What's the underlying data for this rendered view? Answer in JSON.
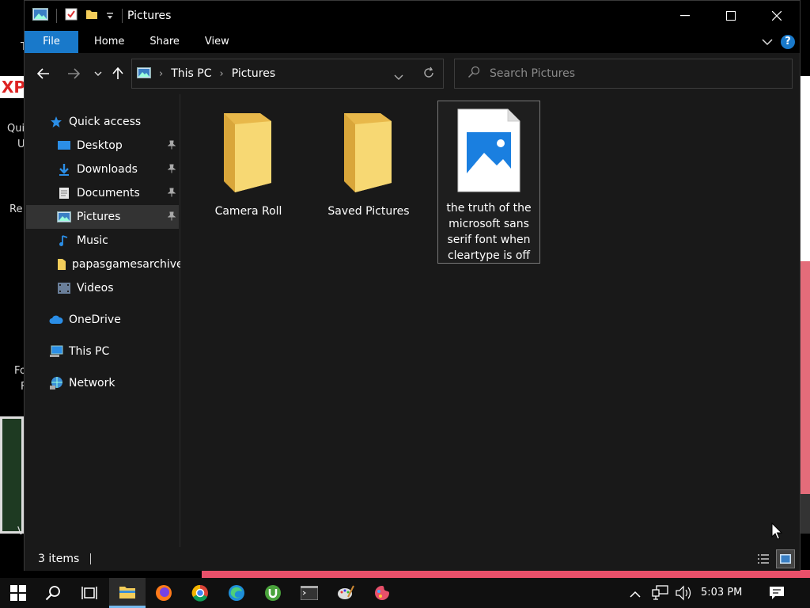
{
  "window": {
    "title": "Pictures",
    "ribbon_tabs": [
      "File",
      "Home",
      "Share",
      "View"
    ]
  },
  "address": {
    "crumbs": [
      "This PC",
      "Pictures"
    ]
  },
  "search": {
    "placeholder": "Search Pictures"
  },
  "nav": {
    "quick_access": "Quick access",
    "items": [
      {
        "label": "Desktop",
        "icon": "desktop-icon",
        "pinned": true
      },
      {
        "label": "Downloads",
        "icon": "downloads-icon",
        "pinned": true
      },
      {
        "label": "Documents",
        "icon": "documents-icon",
        "pinned": true
      },
      {
        "label": "Pictures",
        "icon": "pictures-icon",
        "pinned": true,
        "selected": true
      },
      {
        "label": "Music",
        "icon": "music-icon",
        "pinned": false
      },
      {
        "label": "papasgamesarchive",
        "icon": "folder-icon",
        "pinned": false
      },
      {
        "label": "Videos",
        "icon": "videos-icon",
        "pinned": false
      }
    ],
    "onedrive": "OneDrive",
    "this_pc": "This PC",
    "network": "Network"
  },
  "content": {
    "items": [
      {
        "name": "Camera Roll",
        "type": "folder"
      },
      {
        "name": "Saved Pictures",
        "type": "folder"
      },
      {
        "name": "the truth of the microsoft sans serif font when cleartype is off",
        "type": "image-file",
        "selected": true
      }
    ]
  },
  "status": {
    "count": "3 items"
  },
  "taskbar": {
    "clock": "5:03 PM"
  },
  "desktop_fragments": [
    "T",
    "XP",
    "Qui",
    "U",
    "Re",
    "Fo",
    "F",
    "V"
  ],
  "colors": {
    "accent": "#1979ca",
    "folder": "#f3cd5a",
    "window_bg": "#191919"
  }
}
